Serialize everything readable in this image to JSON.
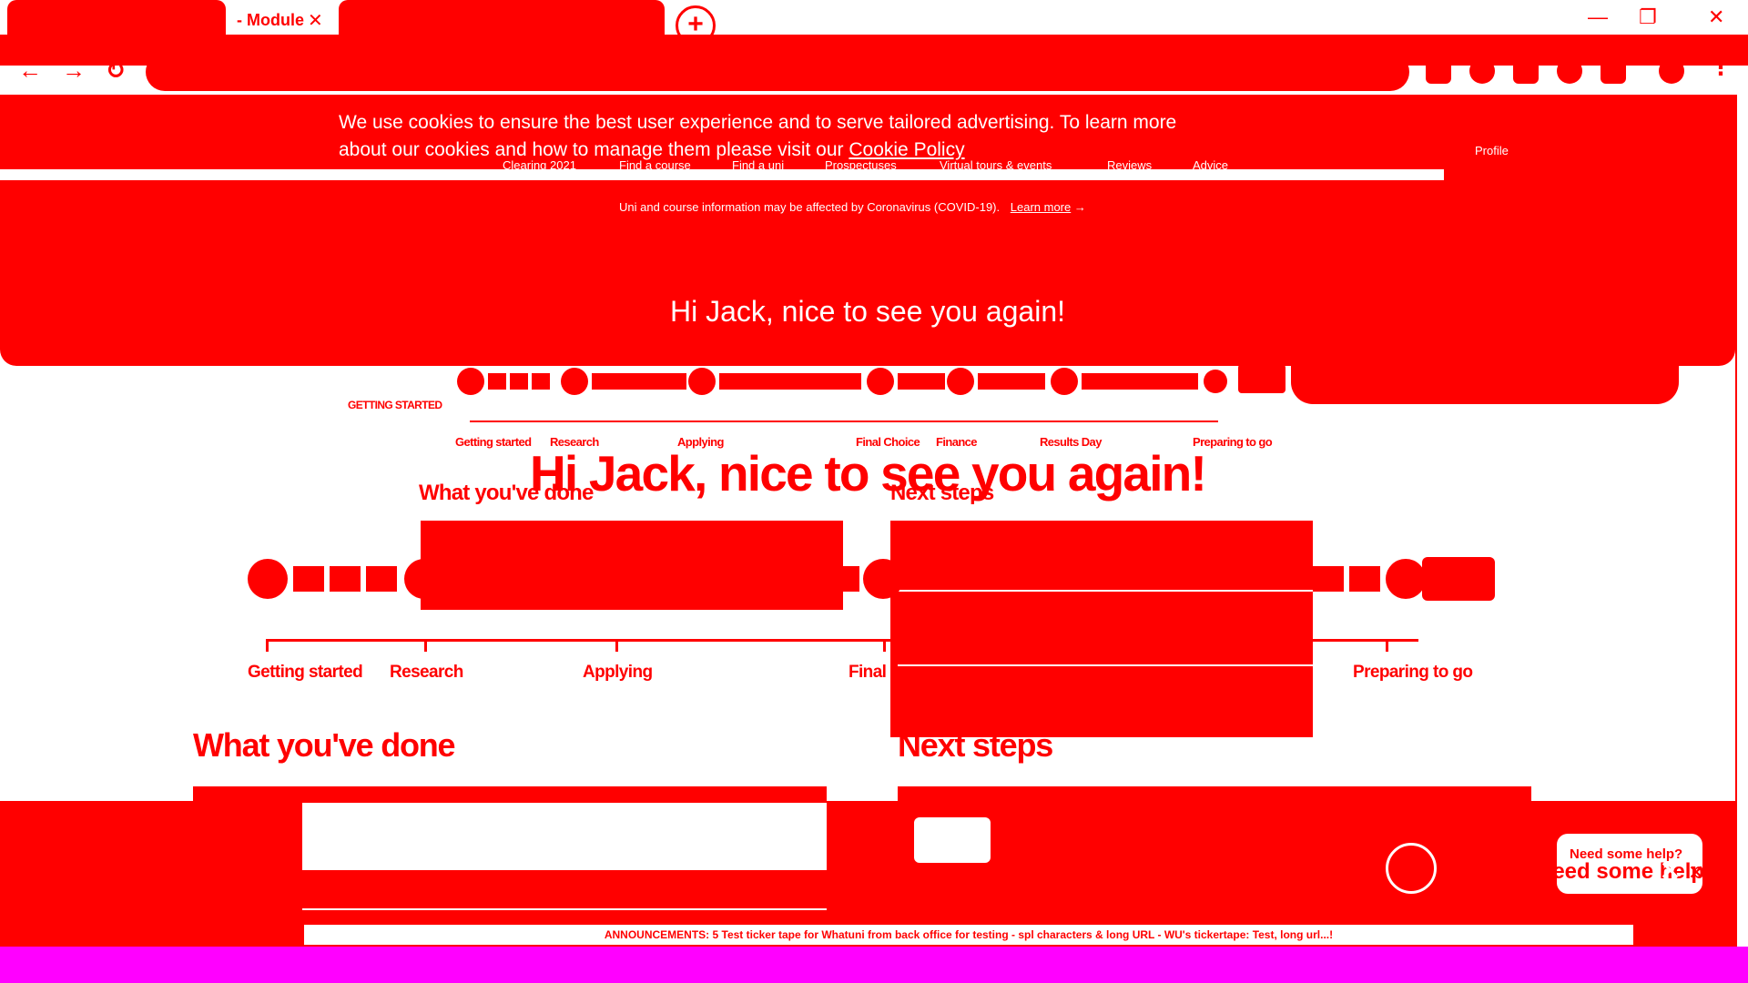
{
  "browser": {
    "tab_active_label": "- Module",
    "tab_close": "✕",
    "new_tab": "+",
    "window_minimize": "—",
    "window_restore": "❐",
    "window_close": "✕",
    "nav_back": "←",
    "nav_forward": "→",
    "nav_reload": "↻"
  },
  "cookie_banner": {
    "text": "We use cookies to ensure the best user experience and to serve tailored advertising. To learn more about our cookies and how to manage them please visit our",
    "link": "Cookie Policy"
  },
  "top_nav": {
    "items": [
      "Clearing 2021",
      "Find a course",
      "Find a uni",
      "Prospectuses",
      "Virtual tours & events",
      "Reviews",
      "Advice"
    ],
    "profile": "Profile"
  },
  "update_strip": {
    "text": "Uni and course information may be affected by Coronavirus (COVID-19).",
    "link": "Learn more"
  },
  "banner_greeting": "Hi Jack, nice to see you again!",
  "small_timeline": {
    "side_label": "GETTING STARTED",
    "stages": [
      "Getting started",
      "Research",
      "Applying",
      "Final Choice",
      "Finance",
      "Results Day",
      "Preparing to go"
    ]
  },
  "mid_sections": {
    "done": "What you've done",
    "next": "Next steps"
  },
  "greeting": "Hi Jack, nice to see you again!",
  "big_timeline": {
    "stages": [
      "Getting started",
      "Research",
      "Applying",
      "Final",
      "Preparing to go"
    ]
  },
  "sections": {
    "done_title": "What you've done",
    "next_title": "Next steps"
  },
  "ticker": "ANNOUNCEMENTS: 5 Test ticker tape for Whatuni from back office for testing - spl characters & long URL - WU's tickertape: Test, long url...!",
  "help": {
    "text": "Need some help?",
    "close": "✕"
  },
  "colors": {
    "primary": "#ff0000",
    "taskbar": "#ff00ff"
  }
}
